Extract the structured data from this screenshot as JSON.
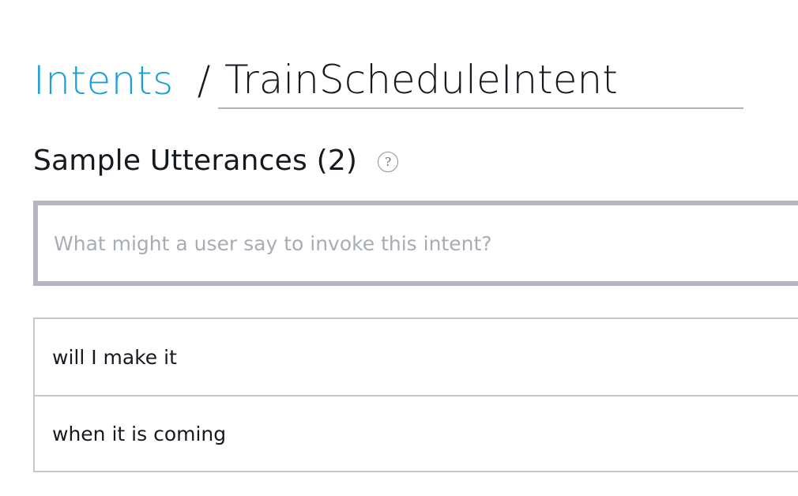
{
  "breadcrumb": {
    "parent_label": "Intents",
    "separator": "/",
    "intent_name": "TrainScheduleIntent"
  },
  "sample_utterances": {
    "title": "Sample Utterances (2)",
    "help_icon": "question-circle-icon",
    "input": {
      "value": "",
      "placeholder": "What might a user say to invoke this intent?"
    },
    "items": [
      {
        "text": "will I make it"
      },
      {
        "text": "when it is coming"
      }
    ]
  },
  "colors": {
    "link": "#1a9fd8",
    "input_border": "#b4b7c0",
    "list_border": "#c5c8cc",
    "placeholder": "#a8acb3"
  }
}
